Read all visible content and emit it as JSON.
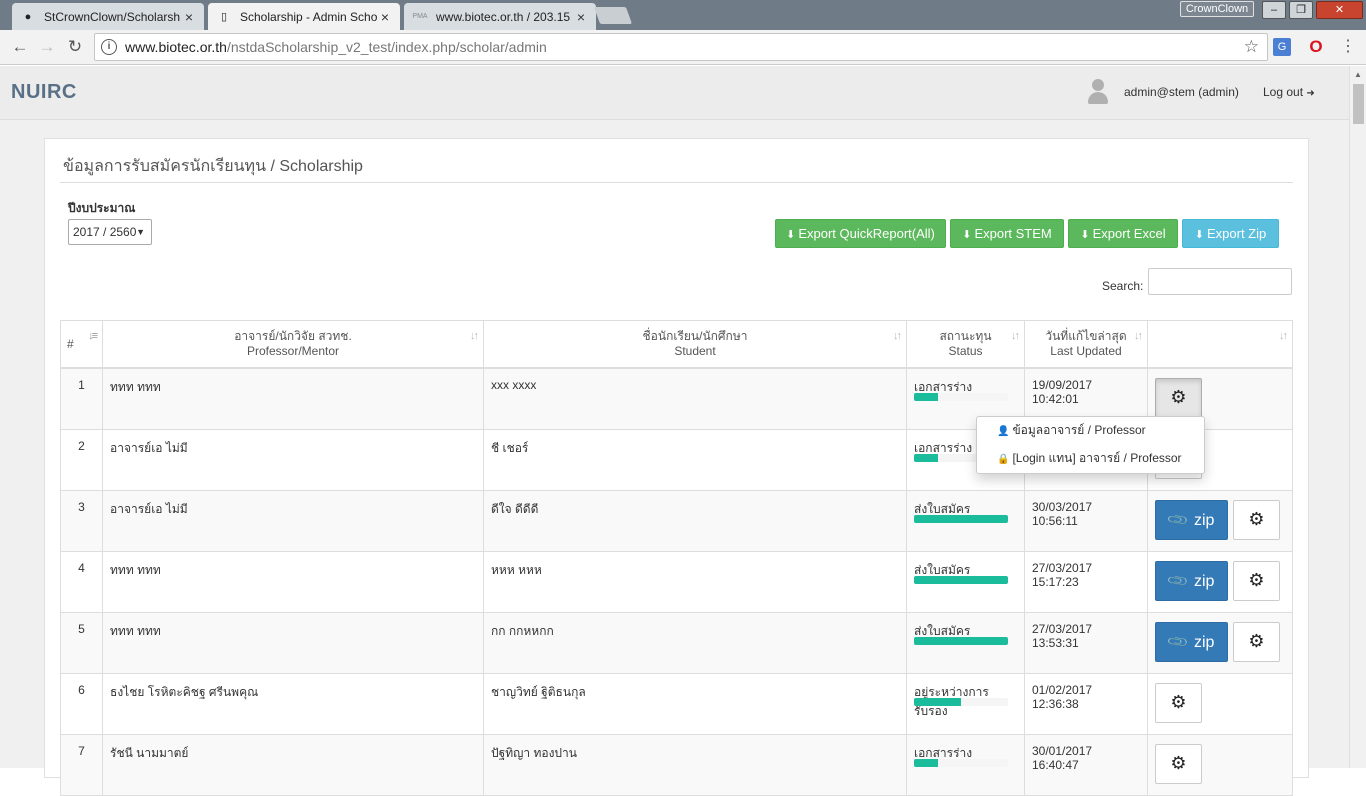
{
  "browser": {
    "tabs": [
      {
        "label": "StCrownClown/Scholarsh",
        "icon": "github-icon"
      },
      {
        "label": "Scholarship - Admin Scho",
        "icon": "page-icon"
      },
      {
        "label": "www.biotec.or.th / 203.15",
        "icon": "pma-icon"
      }
    ],
    "window_user": "CrownClown",
    "url_host": "www.biotec.or.th",
    "url_path": "/nstdaScholarship_v2_test/index.php/scholar/admin"
  },
  "header": {
    "brand": "NUIRC",
    "user": "admin@stem (admin)",
    "logout": "Log out"
  },
  "panel": {
    "title": "ข้อมูลการรับสมัครนักเรียนทุน / Scholarship",
    "fiscal_year_label": "ปีงบประมาณ",
    "fiscal_year_value": "2017 / 2560",
    "buttons": {
      "export_quick": "Export QuickReport(All)",
      "export_stem": "Export STEM",
      "export_excel": "Export Excel",
      "export_zip": "Export Zip"
    },
    "search_label": "Search:"
  },
  "table": {
    "headers": {
      "num": "#",
      "prof_th": "อาจารย์/นักวิจัย สวทช.",
      "prof_en": "Professor/Mentor",
      "student_th": "ชื่อนักเรียน/นักศึกษา",
      "student_en": "Student",
      "status_th": "สถานะทุน",
      "status_en": "Status",
      "updated_th": "วันที่แก้ไขล่าสุด",
      "updated_en": "Last Updated"
    },
    "rows": [
      {
        "num": "1",
        "professor": "ททท ททท",
        "student": "xxx xxxx",
        "status": "เอกสารร่าง",
        "progress": 0.25,
        "updated": "19/09/2017 10:42:01",
        "zip": false
      },
      {
        "num": "2",
        "professor": "อาจารย์เอ ไม่มี",
        "student": "ชี เชอร์",
        "status": "เอกสารร่าง",
        "progress": 0.25,
        "updated": "",
        "zip": false
      },
      {
        "num": "3",
        "professor": "อาจารย์เอ ไม่มี",
        "student": "ดีใจ ดีดีดี",
        "status": "ส่งใบสมัคร",
        "progress": 1.0,
        "updated": "30/03/2017 10:56:11",
        "zip": true
      },
      {
        "num": "4",
        "professor": "ททท ททท",
        "student": "หหห หหห",
        "status": "ส่งใบสมัคร",
        "progress": 1.0,
        "updated": "27/03/2017 15:17:23",
        "zip": true
      },
      {
        "num": "5",
        "professor": "ททท ททท",
        "student": "กก กกหหกก",
        "status": "ส่งใบสมัคร",
        "progress": 1.0,
        "updated": "27/03/2017 13:53:31",
        "zip": true
      },
      {
        "num": "6",
        "professor": "ธงไชย โรหิตะคิชฐ ศรีนพคุณ",
        "student": "ชาญวิทย์ ฐิติธนกุล",
        "status": "อยู่ระหว่างการรับรอง",
        "progress": 0.5,
        "updated": "01/02/2017 12:36:38",
        "zip": false
      },
      {
        "num": "7",
        "professor": "รัชนี นามมาตย์",
        "student": "ปัฐทิญา ทองปาน",
        "status": "เอกสารร่าง",
        "progress": 0.25,
        "updated": "30/01/2017 16:40:47",
        "zip": false
      }
    ],
    "zip_label": "zip"
  },
  "dropdown": {
    "item1": "ข้อมูลอาจารย์ / Professor",
    "item2": "[Login แทน] อาจารย์ / Professor"
  }
}
